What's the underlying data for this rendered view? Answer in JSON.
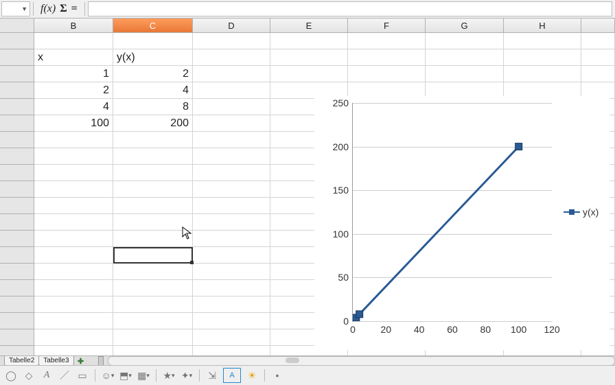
{
  "formula_bar": {
    "cell_ref": "",
    "fx_label": "f(x)",
    "formula_value": ""
  },
  "columns": [
    {
      "letter": "",
      "width": 50
    },
    {
      "letter": "B",
      "width": 115
    },
    {
      "letter": "C",
      "width": 116,
      "selected": true
    },
    {
      "letter": "D",
      "width": 113
    },
    {
      "letter": "E",
      "width": 113
    },
    {
      "letter": "F",
      "width": 113
    },
    {
      "letter": "G",
      "width": 114
    },
    {
      "letter": "H",
      "width": 113
    },
    {
      "letter": "",
      "width": 49
    }
  ],
  "cells": {
    "B": {
      "2": "x",
      "3": "1",
      "4": "2",
      "5": "4",
      "6": "100"
    },
    "C": {
      "2": "y(x)",
      "3": "2",
      "4": "4",
      "5": "8",
      "6": "200"
    }
  },
  "active_cell": "C14",
  "chart_data": {
    "type": "line",
    "series": [
      {
        "name": "y(x)",
        "x": [
          1,
          2,
          4,
          100
        ],
        "y": [
          2,
          4,
          8,
          200
        ]
      }
    ],
    "xlim": [
      0,
      120
    ],
    "ylim": [
      0,
      250
    ],
    "xticks": [
      0,
      20,
      40,
      60,
      80,
      100,
      120
    ],
    "yticks": [
      0,
      50,
      100,
      150,
      200,
      250
    ],
    "line_color": "#2a5a94"
  },
  "sheet_tabs": [
    "Tabelle2",
    "Tabelle3"
  ],
  "bottom_icons": [
    "circle",
    "tri",
    "text",
    "line",
    "rect",
    "sep",
    "smiley",
    "shapes",
    "sep",
    "star",
    "curve",
    "sep",
    "flow",
    "A-box",
    "sun",
    "sep",
    "dot"
  ]
}
